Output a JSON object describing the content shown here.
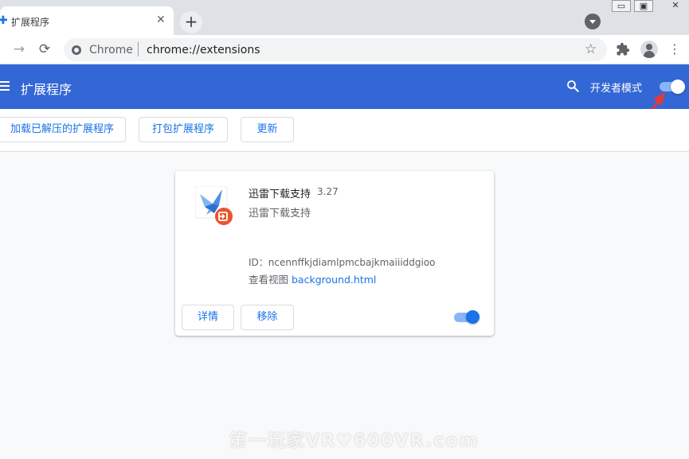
{
  "tab": {
    "title": "扩展程序",
    "close": "✕",
    "new_tab": "+"
  },
  "window": {
    "minimize": "▭",
    "maximize": "▣",
    "close": "✕"
  },
  "toolbar": {
    "back_icon": "→",
    "reload_icon": "⟳",
    "omnibox_site": "Chrome",
    "omnibox_url": "chrome://extensions",
    "star_icon": "☆",
    "menu_icon": "⋮"
  },
  "header": {
    "title": "扩展程序",
    "dev_mode_label": "开发者模式",
    "dev_mode_enabled": true,
    "color": "#3367d6"
  },
  "actions": {
    "load_unpacked": "加载已解压的扩展程序",
    "pack": "打包扩展程序",
    "update": "更新"
  },
  "extension": {
    "name": "迅雷下载支持",
    "version": "3.27",
    "description": "迅雷下载支持",
    "id_text": "ID：ncennffkjdiamlpmcbajkmaiiiddgioo",
    "views_label": "查看视图",
    "views_link": "background.html",
    "details_button": "详情",
    "remove_button": "移除",
    "enabled": true
  },
  "watermark": "第一玩家VR♥600VR.com"
}
